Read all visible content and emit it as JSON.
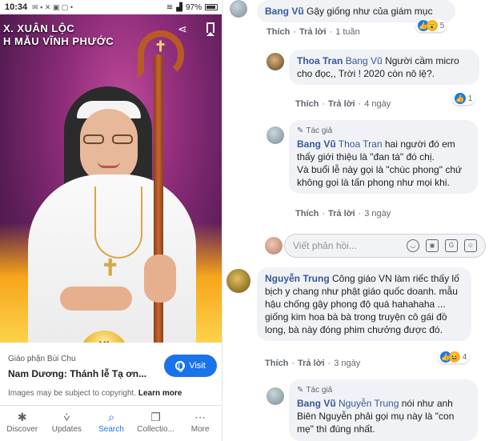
{
  "phone": {
    "status": {
      "time": "10:34",
      "battery": "97%"
    },
    "hero": {
      "title_line1": "X. XUÂN LỘC",
      "title_line2": "H MẪU VĨNH PHƯỚC",
      "chalice_text": "XI"
    },
    "source": "Giáo phận Bùi Chu",
    "title": "Nam Dương: Thánh lễ Tạ ơn...",
    "visit_label": "Visit",
    "copyright_text": "Images may be subject to copyright.",
    "learn_more": "Learn more",
    "nav": [
      {
        "label": "Discover",
        "icon": "asterisk-icon"
      },
      {
        "label": "Updates",
        "icon": "updates-icon"
      },
      {
        "label": "Search",
        "icon": "search-icon"
      },
      {
        "label": "Collectio...",
        "icon": "collections-icon"
      },
      {
        "label": "More",
        "icon": "more-icon"
      }
    ]
  },
  "comments": {
    "c1": {
      "name": "Bang Vũ",
      "text": "Gậy giống như của giám mục",
      "like": "Thích",
      "reply": "Trả lời",
      "time": "1 tuần",
      "reactions": "5"
    },
    "c2": {
      "name": "Thoa Tran",
      "mention": "Bang Vũ",
      "text": "Người cầm micro cho đọc,, Trời ! 2020 còn nô lệ?.",
      "like": "Thích",
      "reply": "Trả lời",
      "time": "4 ngày",
      "reactions": "1"
    },
    "c3": {
      "tag": "Tác giả",
      "name": "Bang Vũ",
      "mention": "Thoa Tran",
      "text_a": "hai người đó em thấy giới thiệu là \"đan tá\" đó chị.",
      "text_b": "Và buổi lễ này gọi là \"chúc phong\" chứ không gọi là tấn phong như mọi khi.",
      "like": "Thích",
      "reply": "Trả lời",
      "time": "3 ngày"
    },
    "write_placeholder": "Viết phản hồi...",
    "c4": {
      "name": "Nguyễn Trung",
      "text": "Công giáo VN làm riếc thấy lố bịch y chang như phật giáo quốc doanh. mẫu hậu chống gậy phong độ quá hahahaha ... giống kim hoa bà bà trong truyện cô gái đồ long, bà này đóng phim chưởng được đó.",
      "like": "Thích",
      "reply": "Trả lời",
      "time": "3 ngày",
      "reactions": "4"
    },
    "c5": {
      "tag": "Tác giả",
      "name": "Bang Vũ",
      "mention": "Nguyễn Trung",
      "text": "nói như anh Biên Nguyễn phải gọi mụ này là \"con mẹ\" thì đúng nhất."
    }
  }
}
